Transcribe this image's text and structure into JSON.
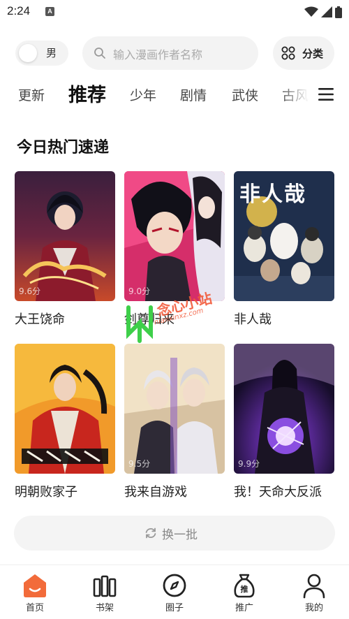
{
  "status_bar": {
    "time": "2:24",
    "notification_glyph": "A"
  },
  "header": {
    "gender_label": "男",
    "search_placeholder": "输入漫画作者名称",
    "category_label": "分类"
  },
  "tabs": [
    {
      "label": "更新",
      "active": false
    },
    {
      "label": "推荐",
      "active": true
    },
    {
      "label": "少年",
      "active": false
    },
    {
      "label": "剧情",
      "active": false
    },
    {
      "label": "武侠",
      "active": false
    },
    {
      "label": "古风",
      "active": false
    }
  ],
  "section": {
    "title": "今日热门速递",
    "items": [
      {
        "title": "大王饶命",
        "score": "9.6分"
      },
      {
        "title": "剑尊归来",
        "score": "9.0分"
      },
      {
        "title": "非人哉",
        "score": "",
        "cover_text": "非人哉"
      },
      {
        "title": "明朝败家子",
        "score": ""
      },
      {
        "title": "我来自游戏",
        "score": "9.5分"
      },
      {
        "title": "我！天命大反派",
        "score": "9.9分"
      }
    ]
  },
  "refresh_label": "换一批",
  "watermark": {
    "text": "念心小站",
    "url": "nianxinxz.com"
  },
  "bottom_nav": [
    {
      "label": "首页",
      "icon": "home-icon",
      "active": true
    },
    {
      "label": "书架",
      "icon": "bookshelf-icon",
      "active": false
    },
    {
      "label": "圈子",
      "icon": "compass-icon",
      "active": false
    },
    {
      "label": "推广",
      "icon": "promote-bag-icon",
      "active": false,
      "badge_text": "推"
    },
    {
      "label": "我的",
      "icon": "profile-icon",
      "active": false
    }
  ],
  "colors": {
    "accent": "#f26b3a",
    "text": "#222222",
    "muted": "#aaaaaa"
  }
}
